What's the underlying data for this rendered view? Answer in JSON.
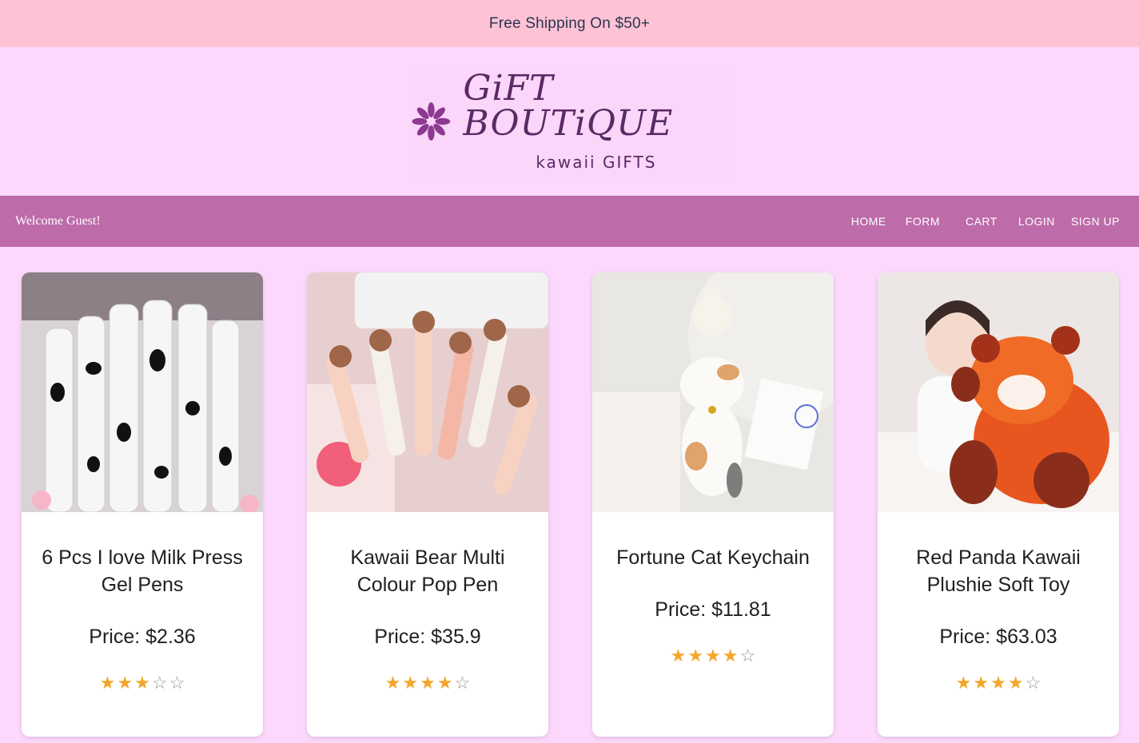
{
  "promo": {
    "text": "Free Shipping On $50+"
  },
  "logo": {
    "title": "GiFT BOUTiQUE",
    "subtitle": "kawaii GIFTS",
    "icon": "flower-icon"
  },
  "navbar": {
    "welcome": "Welcome Guest!",
    "links": [
      "HOME",
      "FORM",
      "CART",
      "LOGIN",
      "SIGN UP"
    ]
  },
  "products": [
    {
      "title": "6 Pcs I love Milk Press Gel Pens",
      "price": "Price: $2.36",
      "rating": 3,
      "max_rating": 5,
      "image": "cow-print-pens"
    },
    {
      "title": "Kawaii Bear Multi Colour Pop Pen",
      "price": "Price: $35.9",
      "rating": 4,
      "max_rating": 5,
      "image": "bear-pens"
    },
    {
      "title": "Fortune Cat Keychain",
      "price": "Price: $11.81",
      "rating": 4,
      "max_rating": 5,
      "image": "cat-keychain"
    },
    {
      "title": "Red Panda Kawaii Plushie Soft Toy",
      "price": "Price: $63.03",
      "rating": 4,
      "max_rating": 5,
      "image": "red-panda-plush"
    }
  ],
  "colors": {
    "promo_bg": "#fdc2d4",
    "page_bg": "#fcd8fd",
    "nav_bg": "#bd6ba9",
    "logo_color": "#5a2a63",
    "star_color": "#f4a62a"
  }
}
